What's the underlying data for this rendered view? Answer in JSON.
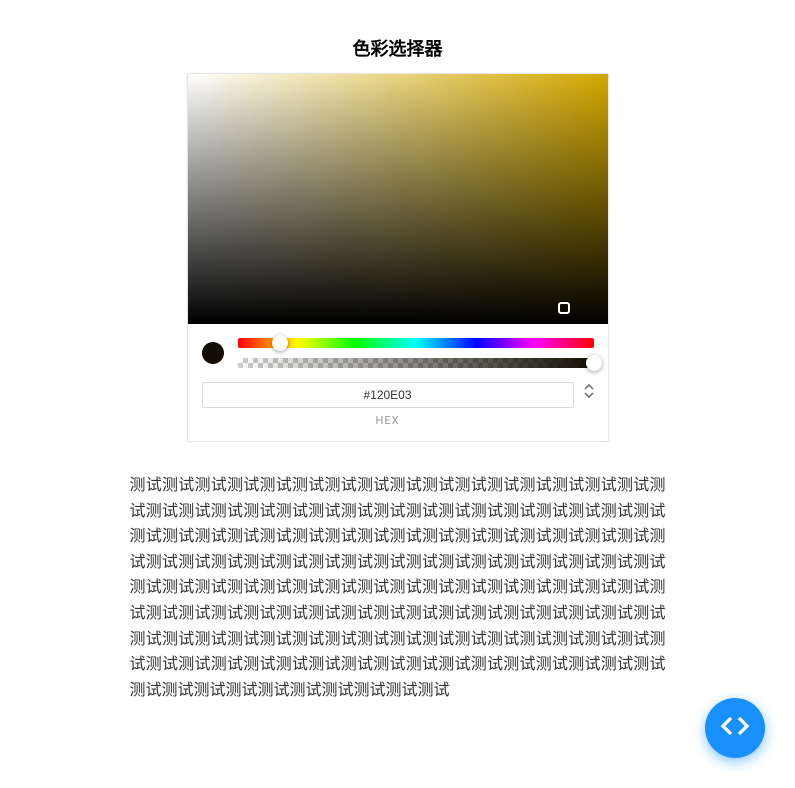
{
  "title": "色彩选择器",
  "picker": {
    "hex_value": "#120E03",
    "format_label": "HEX",
    "preview_color": "#120E03",
    "hue_position_pct": 12,
    "alpha_position_pct": 100
  },
  "test_text": "测试测试测试测试测试测试测试测试测试测试测试测试测试测试测试测试测试测试测试测试测试测试测试测试测试测试测试测试测试测试测试测试测试测试测试测试测试测试测试测试测试测试测试测试测试测试测试测试测试测试测试测试测试测试测试测试测试测试测试测试测试测试测试测试测试测试测试测试测试测试测试测试测试测试测试测试测试测试测试测试测试测试测试测试测试测试测试测试测试测试测试测试测试测试测试测试测试测试测试测试测试测试测试测试测试测试测试测试测试测试测试测试测试测试测试测试测试测试测试测试测试测试测试测试测试测试测试测试测试测试测试测试测试测试测试测试测试测试测试测试测试测试"
}
